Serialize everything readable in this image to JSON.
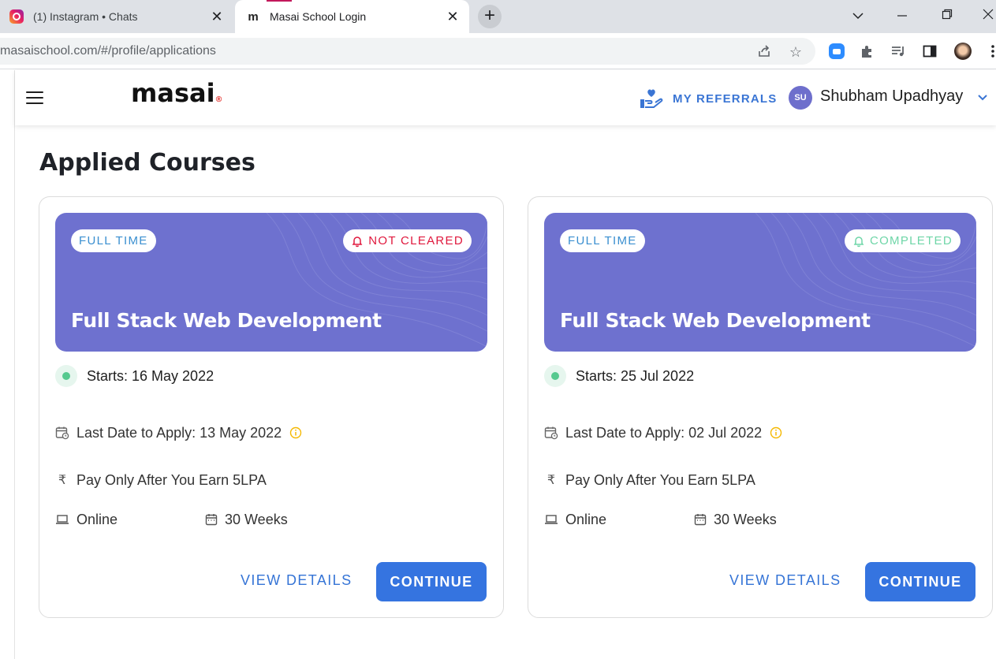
{
  "browser": {
    "tabs": [
      {
        "title": "(1) Instagram • Chats",
        "favicon": "instagram-icon",
        "active": false
      },
      {
        "title": "Masai School Login",
        "favicon": "masai-m-icon",
        "active": true
      }
    ],
    "new_tab_label": "+",
    "url": "masaischool.com/#/profile/applications"
  },
  "header": {
    "logo": "masai",
    "logo_mark": "®",
    "referrals_label": "MY REFERRALS",
    "avatar_initials": "SU",
    "user_name": "Shubham Upadhyay"
  },
  "main": {
    "title": "Applied Courses",
    "cards": [
      {
        "type": "FULL TIME",
        "status": "NOT CLEARED",
        "status_color": "#e0183d",
        "course": "Full Stack Web Development",
        "starts": "Starts: 16 May 2022",
        "last_date": "Last Date to Apply: 13 May 2022",
        "pay": "Pay Only After You Earn 5LPA",
        "mode": "Online",
        "duration": "30 Weeks",
        "view_label": "VIEW DETAILS",
        "continue_label": "CONTINUE"
      },
      {
        "type": "FULL TIME",
        "status": "COMPLETED",
        "status_color": "#6fd6a8",
        "course": "Full Stack Web Development",
        "starts": "Starts: 25 Jul 2022",
        "last_date": "Last Date to Apply: 02 Jul 2022",
        "pay": "Pay Only After You Earn 5LPA",
        "mode": "Online",
        "duration": "30 Weeks",
        "view_label": "VIEW DETAILS",
        "continue_label": "CONTINUE"
      }
    ]
  },
  "colors": {
    "banner": "#6e71cf",
    "accent": "#3574e0",
    "avatar": "#6e6fcc"
  }
}
